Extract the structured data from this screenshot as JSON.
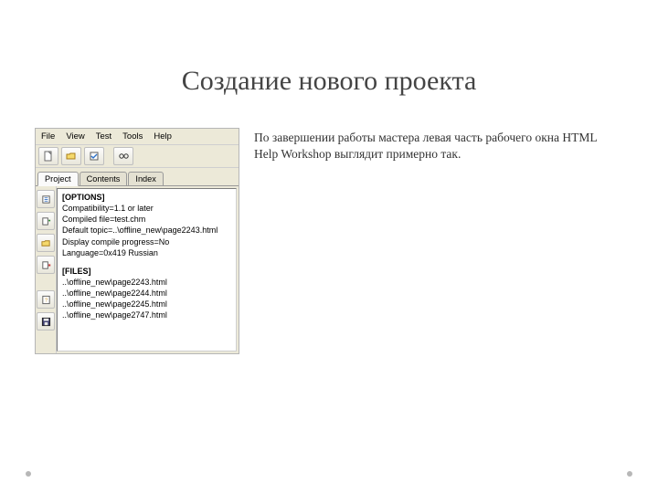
{
  "title": "Создание нового проекта",
  "paragraph": "По завершении работы мастера левая часть рабочего окна HTML Help Workshop выглядит примерно так.",
  "menu": {
    "file": "File",
    "view": "View",
    "test": "Test",
    "tools": "Tools",
    "help": "Help"
  },
  "tabs": {
    "project": "Project",
    "contents": "Contents",
    "index": "Index"
  },
  "listing": {
    "options_header": "[OPTIONS]",
    "opt1": "Compatibility=1.1 or later",
    "opt2": "Compiled file=test.chm",
    "opt3": "Default topic=..\\offline_new\\page2243.html",
    "opt4": "Display compile progress=No",
    "opt5": "Language=0x419 Russian",
    "files_header": "[FILES]",
    "f1": "..\\offline_new\\page2243.html",
    "f2": "..\\offline_new\\page2244.html",
    "f3": "..\\offline_new\\page2245.html",
    "f4": "..\\offline_new\\page2747.html"
  }
}
